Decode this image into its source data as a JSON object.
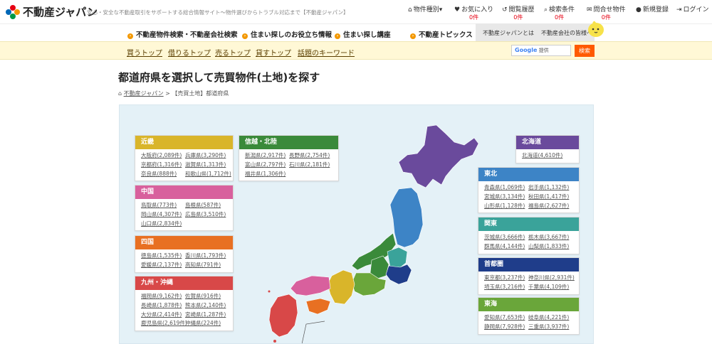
{
  "header": {
    "logo_text": "不動産ジャパン",
    "tagline": "安心・安全な不動産取引をサポートする総合情報サイト〜物件選びからトラブル対応まで【不動産ジャパン】",
    "nav": [
      {
        "label": "物件種別",
        "icon": "home-icon",
        "count": ""
      },
      {
        "label": "お気に入り",
        "icon": "heart-icon",
        "count": "0件"
      },
      {
        "label": "閲覧履歴",
        "icon": "history-icon",
        "count": "0件"
      },
      {
        "label": "検索条件",
        "icon": "search-icon",
        "count": "0件"
      },
      {
        "label": "問合せ物件",
        "icon": "mail-icon",
        "count": "0件"
      },
      {
        "label": "新規登録",
        "icon": "user-icon",
        "count": ""
      },
      {
        "label": "ログイン",
        "icon": "login-icon",
        "count": ""
      }
    ]
  },
  "main_nav": [
    "不動産物件検索・不動産会社検索",
    "住まい探しのお役立ち情報",
    "住まい探し講座",
    "不動産トピックス"
  ],
  "about": [
    "不動産ジャパンとは",
    "不動産会社の皆様へ"
  ],
  "sub_nav": [
    "買うトップ",
    "借りるトップ",
    "売るトップ",
    "貸すトップ",
    "話題のキーワード"
  ],
  "search": {
    "google": "Google",
    "label": "提供",
    "button": "検索"
  },
  "page_title": "都道府県を選択して売買物件(土地)を探す",
  "breadcrumb": {
    "home": "不動産ジャパン",
    "sep": ">",
    "current": "【売買土地】都道府県"
  },
  "regions": [
    {
      "name": "近畿",
      "color": "#d9b52a",
      "items": [
        "大阪府(2,089件)",
        "兵庫県(3,290件)",
        "京都府(1,316件)",
        "滋賀県(1,313件)",
        "奈良県(888件)",
        "和歌山県(1,712件)"
      ]
    },
    {
      "name": "中国",
      "color": "#d8609d",
      "items": [
        "鳥取県(773件)",
        "島根県(587件)",
        "岡山県(4,307件)",
        "広島県(3,510件)",
        "山口県(2,834件)"
      ]
    },
    {
      "name": "四国",
      "color": "#e87022",
      "items": [
        "徳島県(1,535件)",
        "香川県(1,793件)",
        "愛媛県(2,137件)",
        "高知県(791件)"
      ]
    },
    {
      "name": "九州・沖縄",
      "color": "#d84848",
      "items": [
        "福岡県(9,162件)",
        "佐賀県(916件)",
        "長崎県(1,878件)",
        "熊本県(2,140件)",
        "大分県(2,414件)",
        "宮崎県(1,287件)",
        "鹿児島県(2,619件)",
        "沖縄県(224件)"
      ]
    },
    {
      "name": "信越・北陸",
      "color": "#3a8a3a",
      "items": [
        "新潟県(2,917件)",
        "長野県(2,754件)",
        "富山県(2,797件)",
        "石川県(2,181件)",
        "福井県(1,306件)"
      ]
    },
    {
      "name": "北海道",
      "color": "#6a4a9c",
      "items": [
        "北海道(4,610件)"
      ]
    },
    {
      "name": "東北",
      "color": "#3d84c6",
      "items": [
        "青森県(1,069件)",
        "岩手県(1,132件)",
        "宮城県(3,134件)",
        "秋田県(1,417件)",
        "山形県(1,128件)",
        "福島県(2,627件)"
      ]
    },
    {
      "name": "関東",
      "color": "#3aa39a",
      "items": [
        "茨城県(3,666件)",
        "栃木県(3,667件)",
        "群馬県(4,144件)",
        "山梨県(1,833件)"
      ]
    },
    {
      "name": "首都圏",
      "color": "#1f3d8a",
      "items": [
        "東京都(3,237件)",
        "神奈川県(2,931件)",
        "埼玉県(3,216件)",
        "千葉県(4,109件)"
      ]
    },
    {
      "name": "東海",
      "color": "#6aa63a",
      "items": [
        "愛知県(7,653件)",
        "岐阜県(4,221件)",
        "静岡県(7,928件)",
        "三重県(3,937件)"
      ]
    }
  ]
}
